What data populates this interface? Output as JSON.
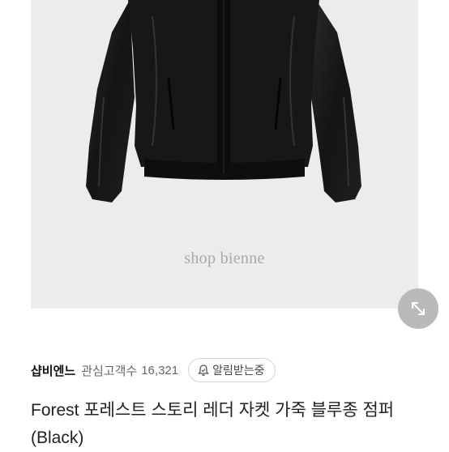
{
  "product": {
    "watermark": "shop bienne",
    "zoom_icon": "expand-arrows-icon",
    "title": "Forest 포레스트 스토리 레더 자켓 가죽 블루종 점퍼 (Black)"
  },
  "shop": {
    "name": "샵비엔느",
    "follower_label": "관심고객수",
    "follower_count": "16,321",
    "notify_label": "알림받는중",
    "notify_icon": "bell-icon"
  },
  "colors": {
    "image_background": "#ececed",
    "jacket": "#151515",
    "zoom_button": "#b9b9bb"
  }
}
